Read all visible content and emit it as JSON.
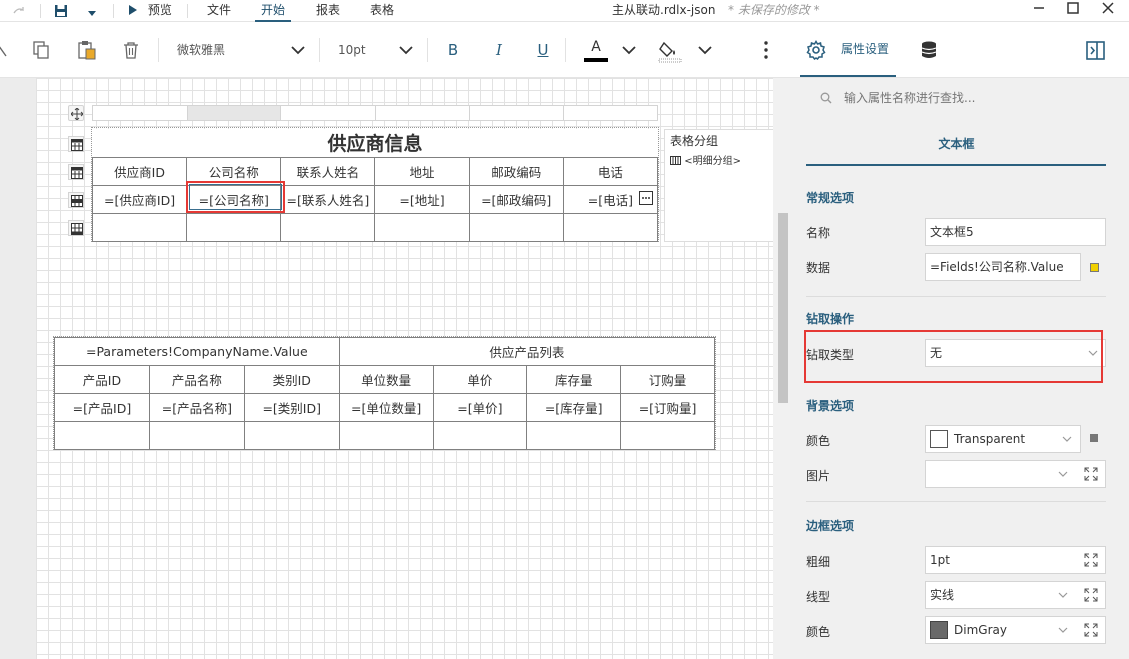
{
  "titlebar": {
    "preview": "预览",
    "menus": [
      "文件",
      "开始",
      "报表",
      "表格"
    ],
    "filename": "主从联动.rdlx-json",
    "unsaved": "* 未保存的修改 *"
  },
  "toolbar": {
    "font_family": "微软雅黑",
    "font_size": "10pt",
    "bold": "B",
    "italic": "I",
    "underline": "U",
    "font_color_glyph": "A",
    "tab_properties": "属性设置"
  },
  "supplier_table": {
    "title": "供应商信息",
    "headers": [
      "供应商ID",
      "公司名称",
      "联系人姓名",
      "地址",
      "邮政编码",
      "电话"
    ],
    "row": [
      "=[供应商ID]",
      "=[公司名称]",
      "=[联系人姓名]",
      "=[地址]",
      "=[邮政编码]",
      "=[电话]"
    ]
  },
  "group_panel": {
    "title": "表格分组",
    "item": "<明细分组>"
  },
  "product_table": {
    "param_header": "=Parameters!CompanyName.Value",
    "list_header": "供应产品列表",
    "headers": [
      "产品ID",
      "产品名称",
      "类别ID",
      "单位数量",
      "单价",
      "库存量",
      "订购量"
    ],
    "row": [
      "=[产品ID]",
      "=[产品名称]",
      "=[类别ID]",
      "=[单位数量]",
      "=[单价]",
      "=[库存量]",
      "=[订购量]"
    ]
  },
  "panel": {
    "search_placeholder": "输入属性名称进行查找...",
    "element_type": "文本框",
    "general": {
      "title": "常规选项",
      "name_label": "名称",
      "name_value": "文本框5",
      "data_label": "数据",
      "data_value": "=Fields!公司名称.Value"
    },
    "drill": {
      "title": "钻取操作",
      "type_label": "钻取类型",
      "type_value": "无"
    },
    "background": {
      "title": "背景选项",
      "color_label": "颜色",
      "color_value": "Transparent",
      "image_label": "图片",
      "image_value": ""
    },
    "border": {
      "title": "边框选项",
      "width_label": "粗细",
      "width_value": "1pt",
      "style_label": "线型",
      "style_value": "实线",
      "color_label": "颜色",
      "color_value": "DimGray"
    }
  },
  "colors": {
    "accent": "#2a5f7e",
    "highlight": "#e53935"
  }
}
